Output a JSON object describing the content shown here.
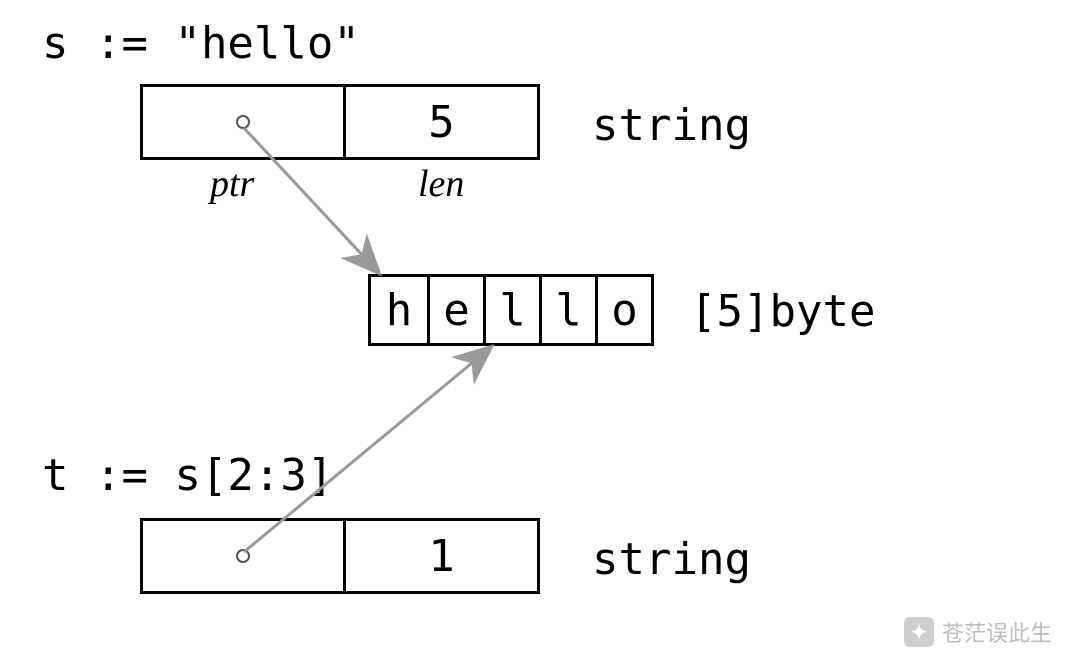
{
  "decl_s": "s := \"hello\"",
  "decl_t": "t := s[2:3]",
  "type_string": "string",
  "type_bytes": "[5]byte",
  "header_s": {
    "len": "5"
  },
  "header_t": {
    "len": "1"
  },
  "field_ptr": "ptr",
  "field_len": "len",
  "bytes": [
    "h",
    "e",
    "l",
    "l",
    "o"
  ],
  "watermark": "苍茫误此生"
}
